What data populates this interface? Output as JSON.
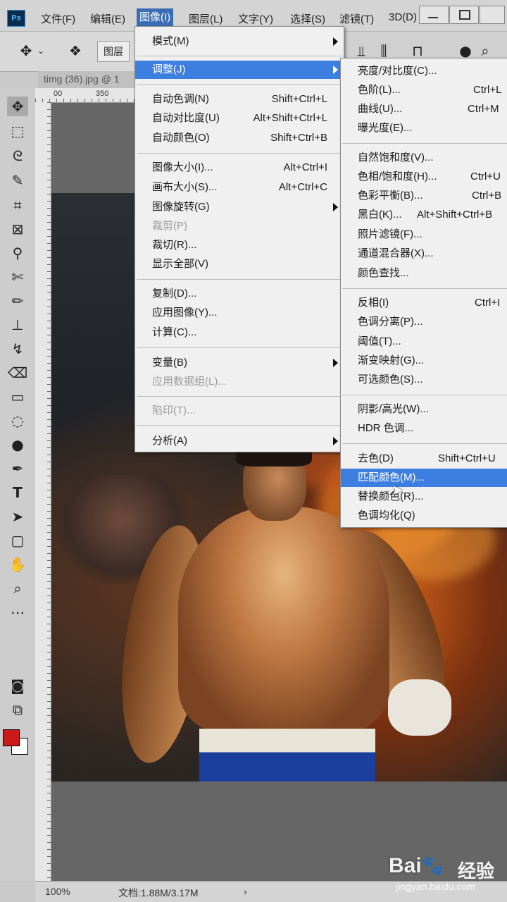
{
  "app": {
    "logo": "Ps"
  },
  "menubar": [
    {
      "label": "文件(F)",
      "active": false
    },
    {
      "label": "编辑(E)",
      "active": false
    },
    {
      "label": "图像(I)",
      "active": true
    },
    {
      "label": "图层(L)",
      "active": false
    },
    {
      "label": "文字(Y)",
      "active": false
    },
    {
      "label": "选择(S)",
      "active": false
    },
    {
      "label": "滤镜(T)",
      "active": false
    },
    {
      "label": "3D(D)",
      "active": false
    }
  ],
  "options": {
    "layer_label": "图层"
  },
  "document": {
    "tab": "timg (36).jpg @ 1",
    "ruler_marks": [
      "00",
      "350"
    ]
  },
  "statusbar": {
    "zoom": "100%",
    "doc_info": "文档:1.88M/3.17M",
    "arrow": "›"
  },
  "image_menu": {
    "items": [
      {
        "label": "模式(M)",
        "shortcut": "",
        "submenu": true,
        "disabled": false
      },
      {
        "label": "调整(J)",
        "shortcut": "",
        "submenu": true,
        "disabled": false,
        "highlight": true
      },
      {
        "label": "自动色调(N)",
        "shortcut": "Shift+Ctrl+L"
      },
      {
        "label": "自动对比度(U)",
        "shortcut": "Alt+Shift+Ctrl+L"
      },
      {
        "label": "自动颜色(O)",
        "shortcut": "Shift+Ctrl+B"
      },
      {
        "label": "图像大小(I)...",
        "shortcut": "Alt+Ctrl+I"
      },
      {
        "label": "画布大小(S)...",
        "shortcut": "Alt+Ctrl+C"
      },
      {
        "label": "图像旋转(G)",
        "shortcut": "",
        "submenu": true
      },
      {
        "label": "裁剪(P)",
        "shortcut": "",
        "disabled": true
      },
      {
        "label": "裁切(R)...",
        "shortcut": ""
      },
      {
        "label": "显示全部(V)",
        "shortcut": ""
      },
      {
        "label": "复制(D)...",
        "shortcut": ""
      },
      {
        "label": "应用图像(Y)...",
        "shortcut": ""
      },
      {
        "label": "计算(C)...",
        "shortcut": ""
      },
      {
        "label": "变量(B)",
        "shortcut": "",
        "submenu": true
      },
      {
        "label": "应用数据组(L)...",
        "shortcut": "",
        "disabled": true
      },
      {
        "label": "陷印(T)...",
        "shortcut": "",
        "disabled": true
      },
      {
        "label": "分析(A)",
        "shortcut": "",
        "submenu": true
      }
    ]
  },
  "adjust_menu": {
    "items": [
      {
        "label": "亮度/对比度(C)...",
        "shortcut": ""
      },
      {
        "label": "色阶(L)...",
        "shortcut": "Ctrl+L"
      },
      {
        "label": "曲线(U)...",
        "shortcut": "Ctrl+M"
      },
      {
        "label": "曝光度(E)...",
        "shortcut": ""
      },
      {
        "label": "自然饱和度(V)...",
        "shortcut": ""
      },
      {
        "label": "色相/饱和度(H)...",
        "shortcut": "Ctrl+U"
      },
      {
        "label": "色彩平衡(B)...",
        "shortcut": "Ctrl+B"
      },
      {
        "label": "黑白(K)...",
        "shortcut": "Alt+Shift+Ctrl+B"
      },
      {
        "label": "照片滤镜(F)...",
        "shortcut": ""
      },
      {
        "label": "通道混合器(X)...",
        "shortcut": ""
      },
      {
        "label": "颜色查找...",
        "shortcut": ""
      },
      {
        "label": "反相(I)",
        "shortcut": "Ctrl+I"
      },
      {
        "label": "色调分离(P)...",
        "shortcut": ""
      },
      {
        "label": "阈值(T)...",
        "shortcut": ""
      },
      {
        "label": "渐变映射(G)...",
        "shortcut": ""
      },
      {
        "label": "可选颜色(S)...",
        "shortcut": ""
      },
      {
        "label": "阴影/高光(W)...",
        "shortcut": ""
      },
      {
        "label": "HDR 色调...",
        "shortcut": ""
      },
      {
        "label": "去色(D)",
        "shortcut": "Shift+Ctrl+U"
      },
      {
        "label": "匹配颜色(M)...",
        "shortcut": "",
        "highlight": true
      },
      {
        "label": "替换颜色(R)...",
        "shortcut": ""
      },
      {
        "label": "色调均化(Q)",
        "shortcut": ""
      }
    ]
  },
  "watermark": {
    "brand": "Bai",
    "brand_cn": "经验",
    "url": "jingyan.baidu.com"
  },
  "colors": {
    "menu_highlight": "#3d7fe0",
    "foreground_swatch": "#cc1a1a",
    "background_swatch": "#ffffff"
  }
}
